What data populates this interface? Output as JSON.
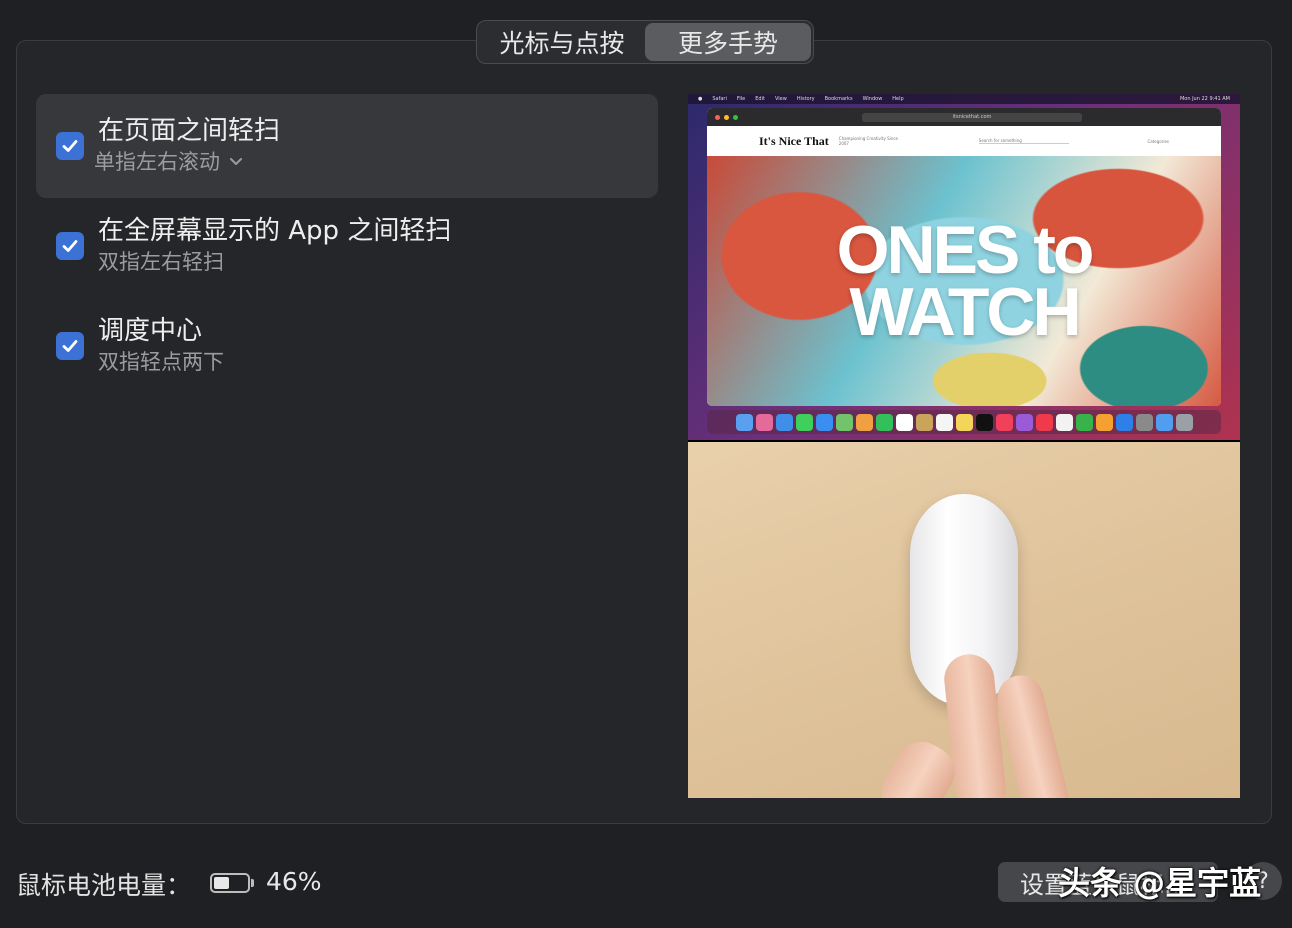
{
  "tabs": [
    {
      "label": "光标与点按",
      "active": false
    },
    {
      "label": "更多手势",
      "active": true
    }
  ],
  "gestures": [
    {
      "title": "在页面之间轻扫",
      "subtitle": "单指左右滚动",
      "checked": true,
      "selected": true,
      "has_dropdown": true
    },
    {
      "title": "在全屏幕显示的 App 之间轻扫",
      "subtitle": "双指左右轻扫",
      "checked": true,
      "selected": false,
      "has_dropdown": false
    },
    {
      "title": "调度中心",
      "subtitle": "双指轻点两下",
      "checked": true,
      "selected": false,
      "has_dropdown": false
    }
  ],
  "preview": {
    "menubar_app": "Safari",
    "menubar_items": [
      "File",
      "Edit",
      "View",
      "History",
      "Bookmarks",
      "Window",
      "Help"
    ],
    "menubar_clock": "Mon Jun 22 9:41 AM",
    "url": "itsnicethat.com",
    "site_logo": "It's Nice That",
    "site_tagline": "Championing Creativity Since 2007",
    "search_placeholder": "Search for something",
    "categories_label": "Categories",
    "hero_line1": "ONES to",
    "hero_line2": "WATCH"
  },
  "battery": {
    "label": "鼠标电池电量：",
    "percent": "46%",
    "level": 0.46
  },
  "setup_button_label": "设置蓝牙鼠标…",
  "help_button_label": "?",
  "watermark": "头条 @星宇蓝",
  "colors": {
    "accent": "#3c72d6",
    "background": "#1f2023",
    "panel": "#252629"
  }
}
